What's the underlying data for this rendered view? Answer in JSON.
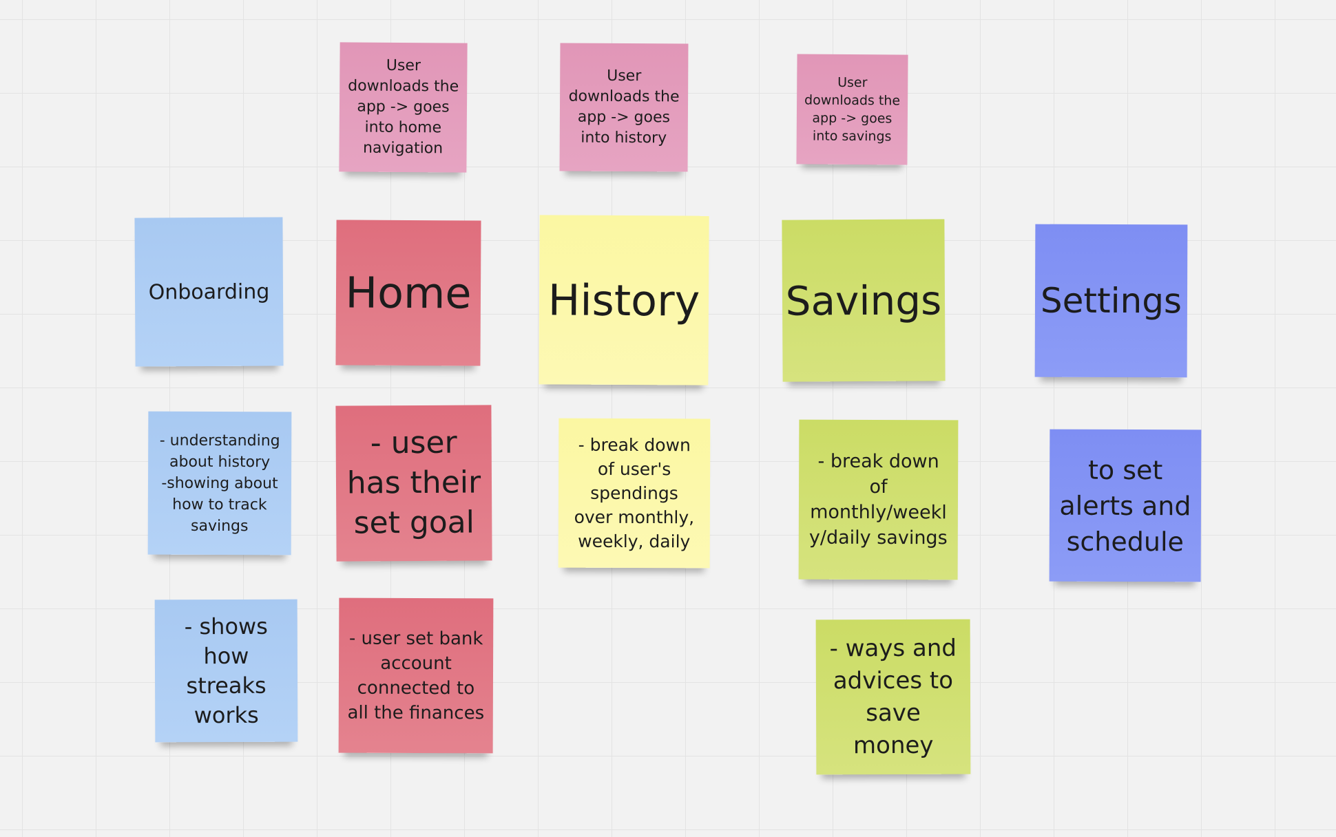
{
  "board": {
    "colors": {
      "background": "#f2f2f2",
      "grid": "#e3e3e3",
      "pink": "#e196b7",
      "red": "#df6e7d",
      "yellow": "#fbf7a2",
      "green": "#cbdc65",
      "blue": "#a8c9f2",
      "purple": "#7e8ef3"
    },
    "notes": {
      "pink_home": "User\ndownloads the\napp -> goes\ninto home\nnavigation",
      "pink_history": "User\ndownloads the\napp -> goes\ninto history",
      "pink_savings": "User\ndownloads the\napp -> goes\ninto savings",
      "onboarding": "Onboarding",
      "home": "Home",
      "history": "History",
      "savings": "Savings",
      "settings": "Settings",
      "onboarding_detail_1": "- understanding\nabout history\n-showing about\nhow to track\nsavings",
      "home_detail_1": "- user\nhas their\nset goal",
      "history_detail_1": "- break down\nof user's\nspendings\nover monthly,\nweekly, daily",
      "savings_detail_1": "- break down\nof\nmonthly/weekl\ny/daily savings",
      "settings_detail_1": "to set\nalerts and\nschedule",
      "onboarding_detail_2": "- shows\nhow\nstreaks\nworks",
      "home_detail_2": "- user set bank\naccount\nconnected to\nall the finances",
      "savings_detail_2": "- ways and\nadvices to\nsave\nmoney"
    }
  }
}
